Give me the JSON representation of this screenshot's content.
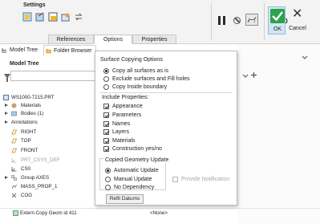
{
  "ribbon": {
    "settings_title": "Settings",
    "ok_label": "OK",
    "cancel_label": "Cancel",
    "tabs": [
      {
        "label": "References"
      },
      {
        "label": "Options"
      },
      {
        "label": "Properties"
      }
    ],
    "icons": [
      "surface-copy-icon",
      "exclude-icon",
      "fill-icon",
      "seed-icon",
      "flip-icon",
      "pause-icon",
      "no-preview-icon",
      "preview-icon",
      "verify-glasses-icon"
    ]
  },
  "left_panel": {
    "tabs": [
      {
        "label": "Model Tree"
      },
      {
        "label": "Folder Browser"
      }
    ],
    "title": "Model Tree",
    "tree": [
      {
        "label": "WS1000-7215.PRT"
      },
      {
        "label": "Materials"
      },
      {
        "label": "Bodies (1)"
      },
      {
        "label": "Annotations"
      },
      {
        "label": "RIGHT"
      },
      {
        "label": "TOP"
      },
      {
        "label": "FRONT"
      },
      {
        "label": "PRT_CSYS_DEF"
      },
      {
        "label": "CS0"
      },
      {
        "label": "Group AXES"
      },
      {
        "label": "MASS_PROP_1"
      },
      {
        "label": "COG"
      }
    ]
  },
  "bottom_row": {
    "feature": "Extern Copy Geom id 411",
    "value": "<None>"
  },
  "dialog": {
    "surface_title": "Surface Copying Options",
    "surface_options": [
      {
        "label": "Copy all surfaces as is",
        "selected": true
      },
      {
        "label": "Exclude surfaces and Fill holes",
        "selected": false
      },
      {
        "label": "Copy Inside boundary",
        "selected": false
      }
    ],
    "include_title": "Include Properties:",
    "include_options": [
      {
        "label": "Appearance",
        "checked": true
      },
      {
        "label": "Parameters",
        "checked": true
      },
      {
        "label": "Names",
        "checked": true
      },
      {
        "label": "Layers",
        "checked": true
      },
      {
        "label": "Materials",
        "checked": true
      },
      {
        "label": "Construction yes/no",
        "checked": true
      }
    ],
    "update_title": "Copied Geometry Update",
    "update_options": [
      {
        "label": "Automatic Update",
        "selected": true
      },
      {
        "label": "Manual Update",
        "selected": false
      },
      {
        "label": "No Dependency",
        "selected": false
      }
    ],
    "provide_notification": "Provide Notification",
    "refit_label": "Refit Datums"
  },
  "colors": {
    "ok_green": "#2ea24a",
    "ribbon_bg": "#f3f3f3",
    "selection_blue": "#d0e6f7"
  }
}
